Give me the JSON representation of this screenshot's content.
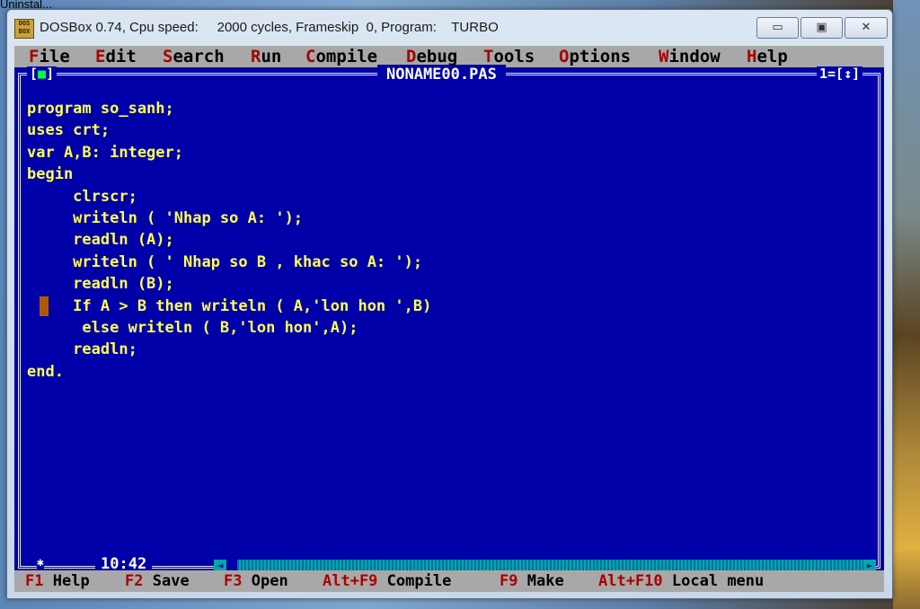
{
  "desktop": {
    "label": "Uninstal..."
  },
  "window": {
    "title": "DOSBox 0.74, Cpu speed:     2000 cycles, Frameskip  0, Program:    TURBO",
    "icon_text": "DOS BOX",
    "controls": {
      "minimize": "▭",
      "maximize": "▣",
      "close": "✕"
    }
  },
  "menu": [
    {
      "hot": "F",
      "rest": "ile"
    },
    {
      "hot": "E",
      "rest": "dit"
    },
    {
      "hot": "S",
      "rest": "earch"
    },
    {
      "hot": "R",
      "rest": "un"
    },
    {
      "hot": "C",
      "rest": "ompile"
    },
    {
      "hot": "D",
      "rest": "ebug"
    },
    {
      "hot": "T",
      "rest": "ools"
    },
    {
      "hot": "O",
      "rest": "ptions"
    },
    {
      "hot": "W",
      "rest": "indow"
    },
    {
      "hot": "H",
      "rest": "elp"
    }
  ],
  "editor": {
    "filename": "NONAME00.PAS",
    "window_number": "1",
    "close_box_left": "[",
    "close_box_glyph": "■",
    "close_box_right": "]",
    "zoom_box": "=[↕]",
    "cursor_position": "10:42",
    "code_lines": [
      "program so_sanh;",
      "uses crt;",
      "var A,B: integer;",
      "begin",
      "     clrscr;",
      "     writeln ( 'Nhap so A: ');",
      "     readln (A);",
      "     writeln ( ' Nhap so B , khac so A: ');",
      "     readln (B);",
      "     If A > B then writeln ( A,'lon hon ',B)",
      "      else writeln ( B,'lon hon',A);",
      "     readln;",
      "end."
    ]
  },
  "status": [
    {
      "key": "F1",
      "label": "Help"
    },
    {
      "key": "F2",
      "label": "Save"
    },
    {
      "key": "F3",
      "label": "Open"
    },
    {
      "key": "Alt+F9",
      "label": "Compile"
    },
    {
      "key": "F9",
      "label": "Make"
    },
    {
      "key": "Alt+F10",
      "label": "Local menu"
    }
  ]
}
